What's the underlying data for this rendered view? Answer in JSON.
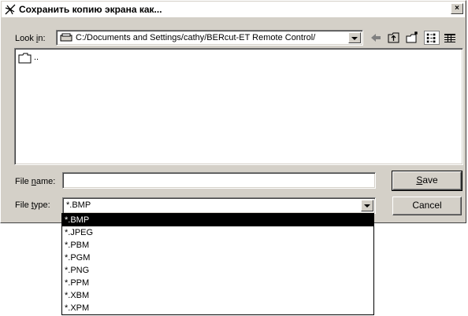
{
  "window": {
    "title": "Сохранить копию экрана как...",
    "close_label": "×"
  },
  "look_in": {
    "label_pre": "Look ",
    "label_accel": "i",
    "label_post": "n:",
    "path": "C:/Documents and Settings/cathy/BERcut-ET Remote Control/"
  },
  "toolbar": {
    "icons": [
      "back-arrow-icon",
      "up-folder-icon",
      "new-folder-icon",
      "list-view-icon",
      "details-view-icon"
    ]
  },
  "file_list": {
    "items": [
      {
        "name": "..",
        "icon": "folder-icon"
      }
    ]
  },
  "file_name": {
    "label_pre": "File ",
    "label_accel": "n",
    "label_post": "ame:",
    "value": ""
  },
  "file_type": {
    "label_pre": "File ",
    "label_accel": "t",
    "label_post": "ype:",
    "value": "*.BMP",
    "options": [
      "*.BMP",
      "*.JPEG",
      "*.PBM",
      "*.PGM",
      "*.PNG",
      "*.PPM",
      "*.XBM",
      "*.XPM"
    ],
    "selected_index": 0
  },
  "buttons": {
    "save_accel": "S",
    "save_rest": "ave",
    "cancel": "Cancel"
  }
}
